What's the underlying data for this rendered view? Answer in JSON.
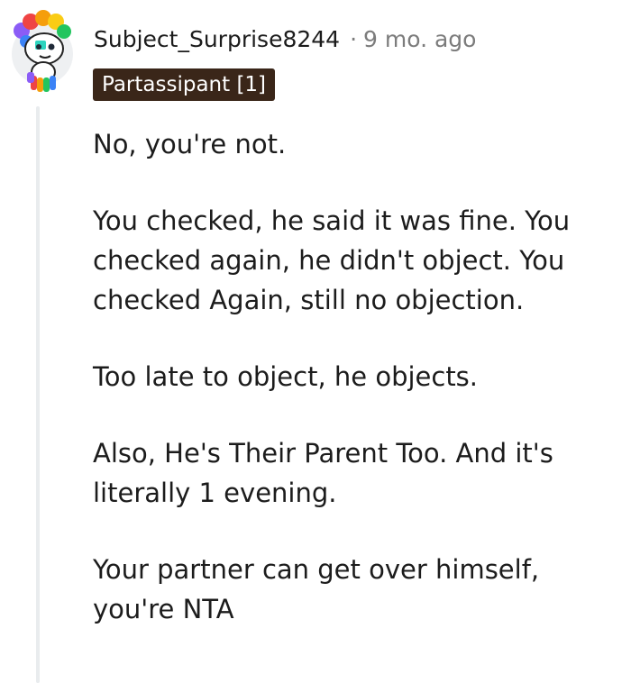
{
  "comment": {
    "author": "Subject_Surprise8244",
    "separator": "·",
    "time_ago": "9 mo. ago",
    "flair": "Partassipant [1]",
    "avatar_icon": "snoo-avatar-icon",
    "paragraphs": [
      "No, you're not.",
      "You checked, he said it was fine. You checked again, he didn't object. You checked Again, still no objection.",
      "Too late to object, he objects.",
      "Also, He's Their Parent Too. And it's literally 1 evening.",
      "Your partner can get over himself, you're NTA"
    ]
  },
  "colors": {
    "flair_background": "#3a2619",
    "flair_text": "#ffffff",
    "meta_muted": "#7c7c7c",
    "thread_line": "#e9ecee"
  }
}
